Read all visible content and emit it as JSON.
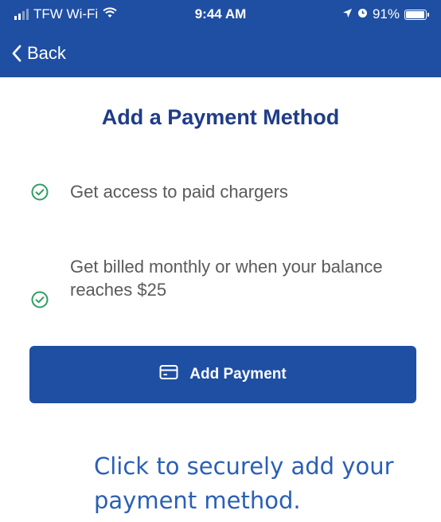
{
  "status_bar": {
    "carrier": "TFW Wi-Fi",
    "time": "9:44 AM",
    "battery": "91%",
    "battery_level": 0.91,
    "icons": [
      "signal-icon",
      "wifi-icon",
      "location-arrow-icon",
      "alarm-icon",
      "battery-icon"
    ]
  },
  "nav": {
    "back_label": "Back",
    "icon": "chevron-left-icon"
  },
  "main": {
    "title": "Add a Payment Method",
    "benefits": [
      {
        "text": "Get access to paid chargers",
        "icon": "check-circle-icon"
      },
      {
        "text": "Get billed monthly or when your balance\nreaches $25",
        "icon": "check-circle-icon"
      }
    ],
    "add_payment_button": {
      "label": "Add Payment",
      "icon": "credit-card-icon"
    }
  },
  "caption": "Click to securely add your payment method.",
  "colors": {
    "brand_blue": "#1f4fa3",
    "title_blue": "#1f3c88",
    "check_green": "#2e9e62",
    "caption_blue": "#2a5fb5",
    "body_text": "#5a5a5a"
  }
}
